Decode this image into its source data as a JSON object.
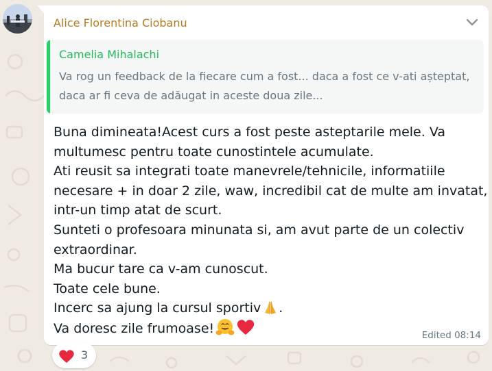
{
  "sender": {
    "name": "Alice Florentina Ciobanu",
    "name_color": "#b57a1e"
  },
  "quote": {
    "author": "Camelia Mihalachi",
    "author_color": "#25b95f",
    "text": "Va rog un feedback de la fiecare cum a fost... daca a fost ce v-ati așteptat, daca ar fi ceva de adăugat in aceste doua zile..."
  },
  "message": {
    "lines": [
      "Buna dimineata!Acest curs a fost peste asteptarile mele. Va",
      "multumesc pentru toate cunostintele acumulate.",
      "Ati reusit sa integrati toate manevrele/tehnicile, informatiile",
      "necesare + in doar 2 zile, waw, incredibil cat de multe am invatat,",
      "intr-un timp atat de scurt.",
      "Sunteti o profesoara minunata si, am avut parte de un colectiv",
      "extraordinar.",
      "Ma bucur tare ca v-am cunoscut.",
      "Toate cele bune.",
      "Incerc sa ajung la cursul sportiv",
      " Va doresc zile frumoase!"
    ],
    "line10_suffix": ".",
    "emoji_icons": [
      "folded-hands-icon",
      "hugging-face-icon",
      "red-heart-icon"
    ],
    "status": "Edited",
    "time": "08:14"
  },
  "reaction": {
    "icon": "red-heart-icon",
    "count": "3"
  },
  "colors": {
    "chat_background": "#efeae2",
    "bubble": "#ffffff",
    "quote_bar": "#25d366",
    "text": "#111b21",
    "meta": "#667781"
  }
}
